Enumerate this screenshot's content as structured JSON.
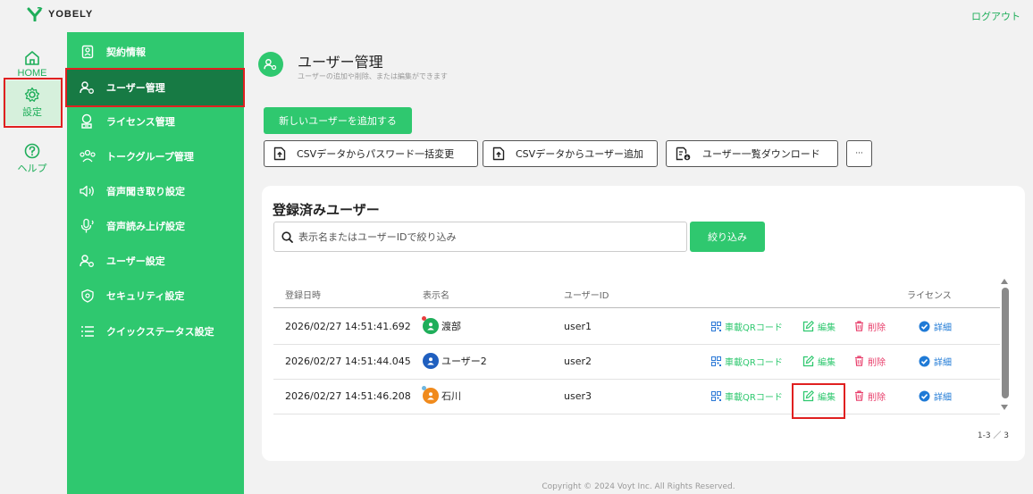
{
  "app": {
    "brand": "YOBELY",
    "logout_label": "ログアウト"
  },
  "rail": {
    "items": [
      {
        "label": "HOME",
        "icon": "home-icon"
      },
      {
        "label": "設定",
        "icon": "gear-icon",
        "active": true
      },
      {
        "label": "ヘルプ",
        "icon": "help-icon"
      }
    ]
  },
  "sidebar": {
    "items": [
      {
        "label": "契約情報",
        "icon": "contract-icon"
      },
      {
        "label": "ユーザー管理",
        "icon": "user-settings-icon",
        "active": true
      },
      {
        "label": "ライセンス管理",
        "icon": "license-icon"
      },
      {
        "label": "トークグループ管理",
        "icon": "group-icon"
      },
      {
        "label": "音声聞き取り設定",
        "icon": "speaker-icon"
      },
      {
        "label": "音声読み上げ設定",
        "icon": "microphone-icon"
      },
      {
        "label": "ユーザー設定",
        "icon": "user-settings-icon"
      },
      {
        "label": "セキュリティ設定",
        "icon": "shield-icon"
      },
      {
        "label": "クイックステータス設定",
        "icon": "list-icon"
      }
    ]
  },
  "page": {
    "title": "ユーザー管理",
    "subtitle": "ユーザーの追加や削除、または編集ができます",
    "add_user_label": "新しいユーザーを追加する",
    "csv_password_label": "CSVデータからパスワード一括変更",
    "csv_add_label": "CSVデータからユーザー追加",
    "download_label": "ユーザー一覧ダウンロード",
    "more_label": "···"
  },
  "users": {
    "title": "登録済みユーザー",
    "search_placeholder": "表示名またはユーザーIDで絞り込み",
    "filter_label": "絞り込み",
    "columns": {
      "date": "登録日時",
      "name": "表示名",
      "user_id": "ユーザーID",
      "license": "ライセンス"
    },
    "action_labels": {
      "qr": "車載QRコード",
      "edit": "編集",
      "delete": "削除",
      "detail": "詳細"
    },
    "rows": [
      {
        "date": "2026/02/27 14:51:41.692",
        "name": "渡部",
        "user_id": "user1",
        "avatar_color": "#1fae5a",
        "dot_color": "#e83e3e"
      },
      {
        "date": "2026/02/27 14:51:44.045",
        "name": "ユーザー2",
        "user_id": "user2",
        "avatar_color": "#1f5fbf",
        "dot_color": ""
      },
      {
        "date": "2026/02/27 14:51:46.208",
        "name": "石川",
        "user_id": "user3",
        "avatar_color": "#f08a1c",
        "dot_color": "#6fb7e0"
      }
    ],
    "pagination": "1-3 ／ 3"
  },
  "footer": {
    "copyright": "Copyright © 2024 Voyt Inc. All Rights Reserved."
  },
  "colors": {
    "green": "#2fc86f",
    "dark_green": "#177a44",
    "red_highlight": "#e02020",
    "delete_red": "#e83e6b",
    "detail_blue": "#1f7ad6"
  }
}
